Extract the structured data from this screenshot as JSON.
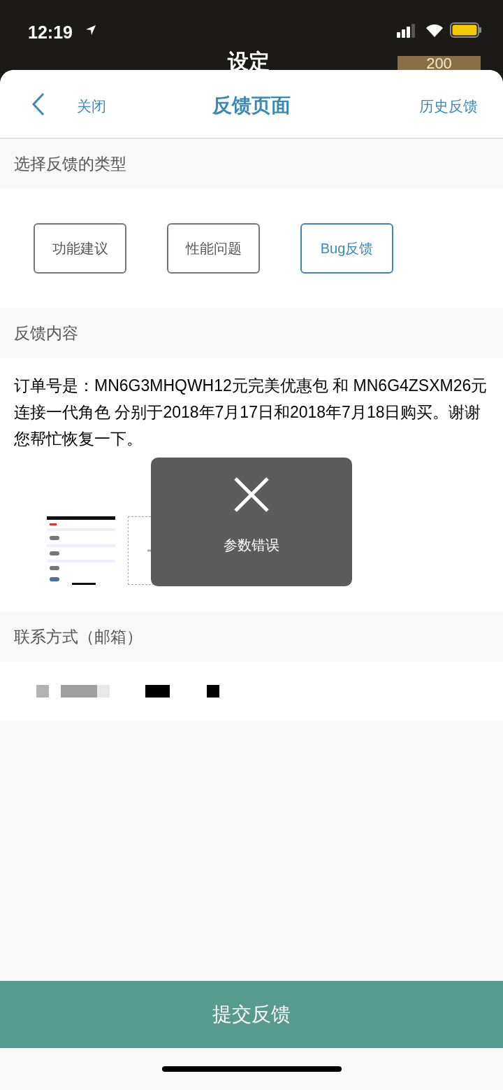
{
  "status_bar": {
    "time": "12:19"
  },
  "behind": {
    "title": "设定",
    "coins": "200"
  },
  "header": {
    "close": "关闭",
    "title": "反馈页面",
    "history": "历史反馈"
  },
  "type_section": {
    "label": "选择反馈的类型"
  },
  "types": [
    {
      "label": "功能建议",
      "selected": false
    },
    {
      "label": "性能问题",
      "selected": false
    },
    {
      "label": "Bug反馈",
      "selected": true
    }
  ],
  "content_section": {
    "label": "反馈内容",
    "text": "订单号是：MN6G3MHQWH12元完美优惠包 和 MN6G4ZSXM26元连接一代角色 分别于2018年7月17日和2018年7月18日购买。谢谢您帮忙恢复一下。"
  },
  "toast": {
    "message": "参数错误"
  },
  "contact_section": {
    "label": "联系方式（邮箱）"
  },
  "submit": "提交反馈"
}
